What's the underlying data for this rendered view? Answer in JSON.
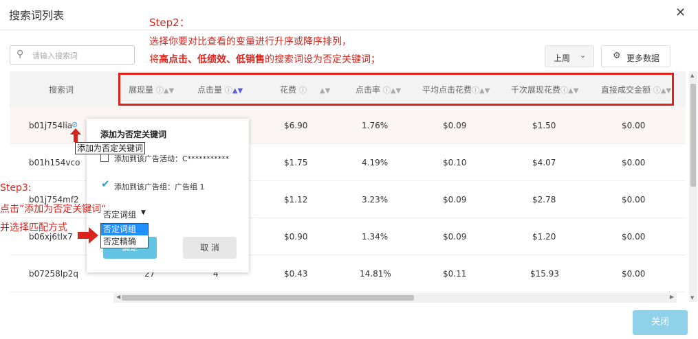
{
  "dialog": {
    "title": "搜索词列表",
    "close_glyph": "✕"
  },
  "search": {
    "placeholder": "请输入搜索词"
  },
  "annotations": {
    "step2_title": "Step2：",
    "step2_line1": "选择你要对比查看的变量进行升序或降序排列，",
    "step2_line2_a": "将",
    "step2_line2_b": "高点击、低绩效、低销售",
    "step2_line2_c": "的搜索词设为否定关键词；",
    "step3_title": "Step3:",
    "step3_line1": "点击”添加为否定关键词“",
    "step3_line2": "并选择匹配方式",
    "accent_color": "#d9241c"
  },
  "toolbar": {
    "period_label": "上周",
    "more_data_label": "更多数据"
  },
  "table": {
    "columns": [
      "搜索词",
      "展现量",
      "点击量",
      "花费",
      "点击率",
      "平均点击花费",
      "千次展现花费",
      "直接成交金额"
    ],
    "rows": [
      {
        "term": "b01j754lia",
        "impressions": "",
        "clicks": "",
        "cost": "$6.90",
        "ctr": "1.76%",
        "cpc": "$0.09",
        "cpm": "$1.50",
        "sales": "$0.00"
      },
      {
        "term": "b01h154vco",
        "impressions": "",
        "clicks": "",
        "cost": "$1.75",
        "ctr": "4.19%",
        "cpc": "$0.10",
        "cpm": "$4.07",
        "sales": "$0.00"
      },
      {
        "term": "b01j754mf2",
        "impressions": "",
        "clicks": "",
        "cost": "$1.12",
        "ctr": "3.23%",
        "cpc": "$0.09",
        "cpm": "$2.78",
        "sales": "$0.00"
      },
      {
        "term": "b06xj6tlx7",
        "impressions": "",
        "clicks": "",
        "cost": "$0.90",
        "ctr": "1.34%",
        "cpc": "$0.09",
        "cpm": "$1.20",
        "sales": "$0.00"
      },
      {
        "term": "b07258lp2q",
        "impressions": "27",
        "clicks": "4",
        "cost": "$0.43",
        "ctr": "14.81%",
        "cpc": "$0.11",
        "cpm": "$15.93",
        "sales": "$0.00"
      }
    ]
  },
  "tooltip": {
    "text": "添加为否定关键词"
  },
  "popup": {
    "title": "添加为否定关键词",
    "option_campaign": "添加到该广告活动：C***********",
    "option_adgroup": "添加到该广告组：广告组 1",
    "match_selected": "否定词组",
    "match_options": [
      "否定词组",
      "否定精确"
    ],
    "ok_label": "确定",
    "cancel_label": "取 消"
  },
  "footer": {
    "close_label": "关闭"
  }
}
